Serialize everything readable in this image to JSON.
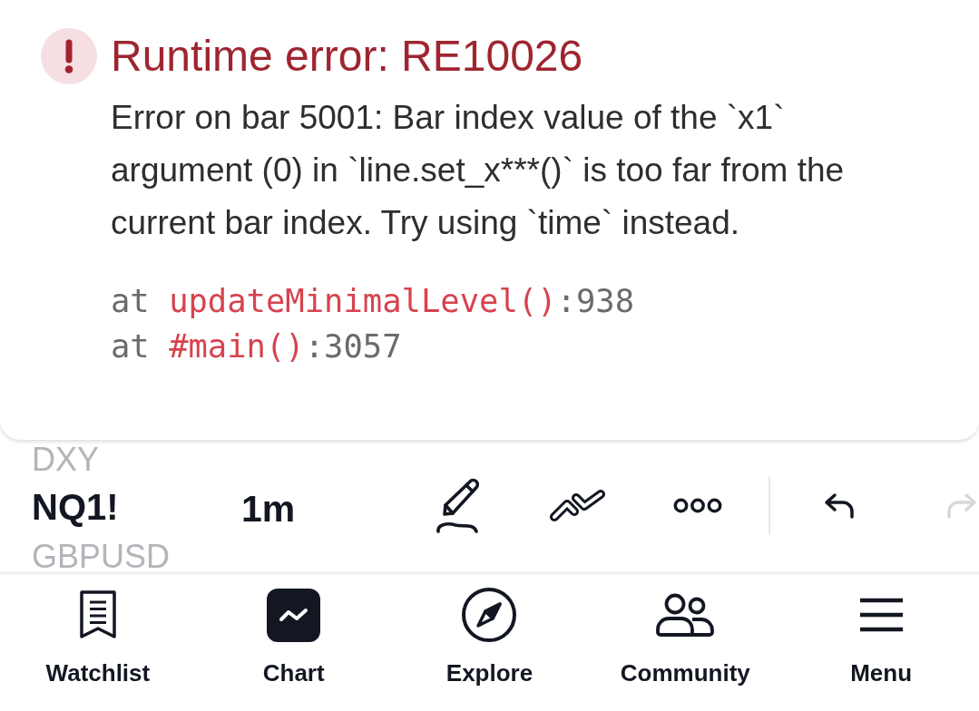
{
  "error_dialog": {
    "title": "Runtime error: RE10026",
    "message": "Error on bar 5001: Bar index value of the `x1` argument (0) in `line.set_x***()` is too far from the current bar index. Try using `time` instead.",
    "stack_trace": [
      {
        "prefix": "at",
        "function": "updateMinimalLevel()",
        "suffix": ":938"
      },
      {
        "prefix": "at",
        "function": "#main()",
        "suffix": ":3057"
      }
    ]
  },
  "toolbar": {
    "symbols": [
      {
        "label": "DXY",
        "selected": false
      },
      {
        "label": "NQ1!",
        "selected": true
      },
      {
        "label": "GBPUSD",
        "selected": false
      }
    ],
    "interval": "1m",
    "undo": {
      "disabled": false
    },
    "redo": {
      "disabled": true
    }
  },
  "bottom_nav": [
    {
      "label": "Watchlist",
      "selected": false
    },
    {
      "label": "Chart",
      "selected": true
    },
    {
      "label": "Explore",
      "selected": false
    },
    {
      "label": "Community",
      "selected": false
    },
    {
      "label": "Menu",
      "selected": false
    }
  ]
}
